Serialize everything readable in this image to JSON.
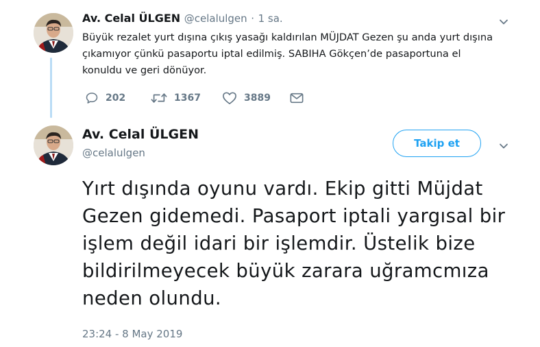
{
  "parent_tweet": {
    "author_name": "Av. Celal ÜLGEN",
    "author_handle": "@celalulgen",
    "separator": "·",
    "time_ago": "1 sa.",
    "text": "Büyük rezalet yurt dışına çıkış yasağı kaldırılan MÜJDAT Gezen şu anda yurt dışına çıkamıyor çünkü pasaportu iptal edilmiş. SABIHA Gökçen’de pasaportuna el konuldu ve geri dönüyor.",
    "replies": "202",
    "retweets": "1367",
    "likes": "3889"
  },
  "main_tweet": {
    "author_name": "Av. Celal ÜLGEN",
    "author_handle": "@celalulgen",
    "follow_label": "Takip et",
    "text": "Yırt dışında oyunu vardı. Ekip gitti Müjdat Gezen gidemedi. Pasaport iptali yargısal bir işlem değil idari bir işlemdir. Üstelik bize bildirilmeyecek büyük zarara uğramcmıza neden olundu.",
    "timestamp": "23:24 - 8 May 2019"
  },
  "colors": {
    "accent": "#1da1f2",
    "muted": "#657786",
    "thread_line": "#b9dcf6"
  }
}
